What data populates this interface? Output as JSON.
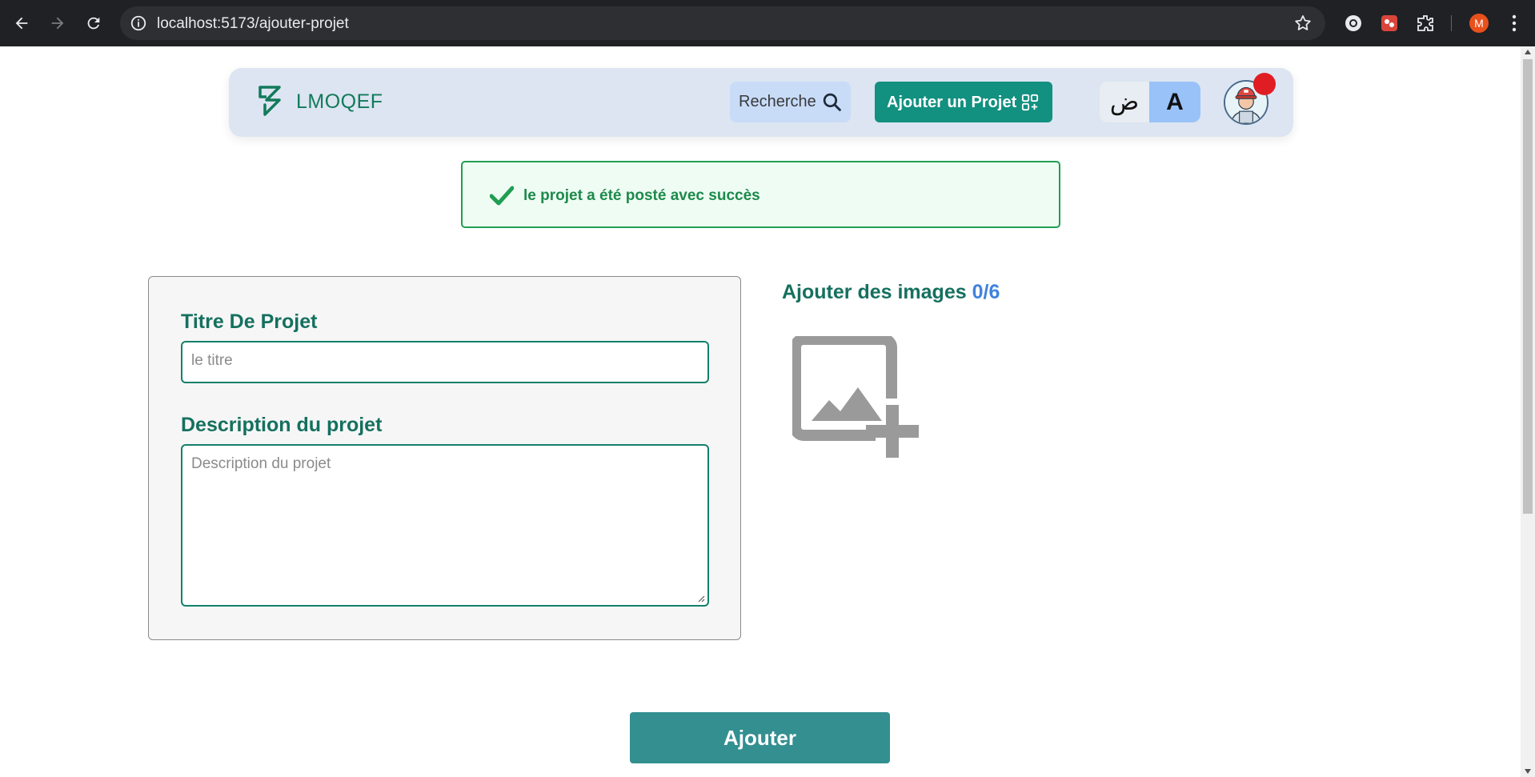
{
  "browser": {
    "url": "localhost:5173/ajouter-projet",
    "profile_initial": "M"
  },
  "header": {
    "brand": "LMOQEF",
    "search_label": "Recherche",
    "add_project_label": "Ajouter un Projet",
    "lang_arabic": "ض",
    "lang_latin": "A"
  },
  "alert": {
    "message": "le projet a été posté avec succès"
  },
  "form": {
    "title_label": "Titre De Projet",
    "title_placeholder": "le titre",
    "title_value": "",
    "description_label": "Description du projet",
    "description_placeholder": "Description du projet",
    "description_value": ""
  },
  "images": {
    "label": "Ajouter des images",
    "count": "0/6"
  },
  "submit_label": "Ajouter",
  "colors": {
    "primary": "#129080",
    "accent_text": "#15705f",
    "success": "#1f9e53",
    "header_bg": "#dce5f1",
    "notification": "#e11d24"
  }
}
